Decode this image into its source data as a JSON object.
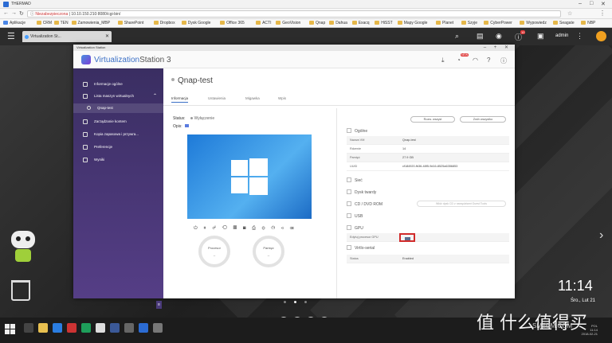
{
  "browser": {
    "window_title": "THERMAD",
    "url_prefix": "Niezabezpieczona",
    "url": "10.10.150.210:8080/cgi-bin/",
    "bookmarks": [
      "Aplikacje",
      "CRM",
      "TEN",
      "Zamowienia_MBP",
      "SharePoint",
      "Dropbox",
      "Dysk Google",
      "Office 365",
      "ACTI",
      "GeoVision",
      "Qnap",
      "Dahua",
      "Exacq",
      "HiSST",
      "Mapy Google",
      "Planet",
      "Szyje",
      "CyberPower",
      "Wypowiedz",
      "Seagate",
      "NBP"
    ]
  },
  "qts": {
    "tab_title": "Virtualization St...",
    "user": "admin",
    "notif_badge": "10"
  },
  "window": {
    "title": "Virtualization Station",
    "app_name_brand": "Virtualization",
    "app_name_rest": "Station 3",
    "notif_badge": "NEW"
  },
  "sidebar": {
    "items": [
      {
        "label": "Informacje ogólne"
      },
      {
        "label": "Lista maszyn wirtualnych"
      },
      {
        "label": "Qnap-test"
      },
      {
        "label": "Zarządzanie kontem"
      },
      {
        "label": "Kopia zapasowa i przywra..."
      },
      {
        "label": "Preferencje"
      },
      {
        "label": "Wyniki"
      }
    ]
  },
  "vm": {
    "name": "Qnap-test",
    "tabs": [
      "Informacja",
      "Ustawienia",
      "Migawka",
      "Wpis"
    ],
    "status_label": "Status:",
    "status_value": "Wyłączenie",
    "opis_label": "Opis:",
    "gauges": [
      {
        "label": "Procesor",
        "value": "--"
      },
      {
        "label": "Pamięć",
        "value": "--"
      }
    ]
  },
  "details": {
    "expand_all": "Rozw. wszyst",
    "collapse_all": "Zwiń wszystko",
    "general_title": "Ogólne",
    "rows": [
      {
        "key": "Nazwa VM",
        "value": "Qnap-test"
      },
      {
        "key": "Rdzenie",
        "value": "14"
      },
      {
        "key": "Pamięć",
        "value": "27.9 GB"
      },
      {
        "key": "UUID",
        "value": "cf184920-fb36-48f5-9d16-8525a6356853"
      }
    ],
    "sections": [
      "Sieć",
      "Dysk twardy",
      "CD / DVD ROM",
      "USB",
      "GPU"
    ],
    "cd_button": "Włóż dysk CD z narzędziami Guest Tools",
    "gpu_row": "Edytuj procesor GPU",
    "serial_title": "VirtIo-serial",
    "serial_status_key": "Status",
    "serial_status_value": "Enabled"
  },
  "desktop": {
    "time": "11:14",
    "date": "Śro., Lut 21"
  },
  "taskbar": {
    "tray_lang": "POL",
    "tray_time": "11:14",
    "tray_date": "2018-02-21"
  },
  "watermark": {
    "main": "值 什么值得买",
    "sub": "SMZDM.COM"
  }
}
